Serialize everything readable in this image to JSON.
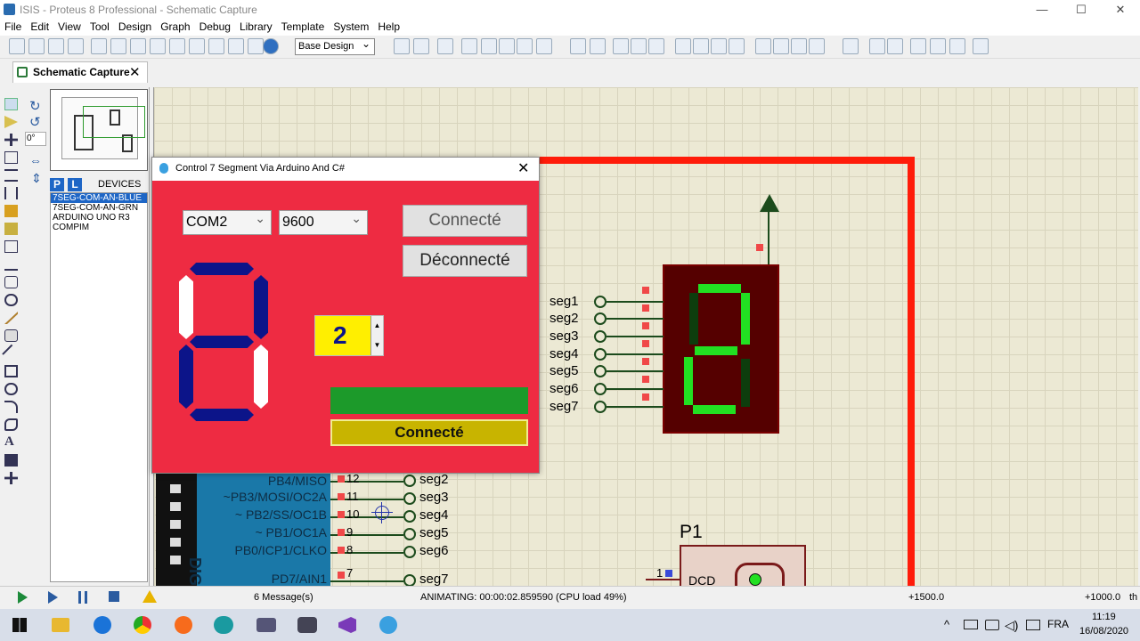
{
  "window": {
    "title": "ISIS - Proteus 8 Professional - Schematic Capture",
    "min": "—",
    "max": "☐",
    "close": "✕"
  },
  "menu": [
    "File",
    "Edit",
    "View",
    "Tool",
    "Design",
    "Graph",
    "Debug",
    "Library",
    "Template",
    "System",
    "Help"
  ],
  "toolbar": {
    "design_combo": "Base Design"
  },
  "tab": {
    "label": "Schematic Capture",
    "close": "✕"
  },
  "left": {
    "rotation": "0°"
  },
  "devices": {
    "p": "P",
    "l": "L",
    "header": "DEVICES",
    "items": [
      "7SEG-COM-AN-BLUE",
      "7SEG-COM-AN-GRN",
      "ARDUINO UNO R3",
      "COMPIM"
    ]
  },
  "schematic": {
    "seg_labels": [
      "seg1",
      "seg2",
      "seg3",
      "seg4",
      "seg5",
      "seg6",
      "seg7"
    ],
    "arduino_pins": [
      {
        "name": "PB4/MISO",
        "num": "12",
        "net": "seg2"
      },
      {
        "name": "~PB3/MOSI/OC2A",
        "num": "11",
        "net": "seg3"
      },
      {
        "name": "~ PB2/SS/OC1B",
        "num": "10",
        "net": "seg4"
      },
      {
        "name": "~ PB1/OC1A",
        "num": "9",
        "net": "seg5"
      },
      {
        "name": "PB0/ICP1/CLKO",
        "num": "8",
        "net": "seg6"
      },
      {
        "name": "PD7/AIN1",
        "num": "7",
        "net": "seg7"
      }
    ],
    "dig_label": "DIG",
    "p1_label": "P1",
    "p1_pin": "1",
    "p1_pin_name": "DCD"
  },
  "dialog": {
    "title": "Control 7 Segment Via Arduino And C#",
    "close": "✕",
    "port": "COM2",
    "baud": "9600",
    "connect_btn": "Connecté",
    "disconnect_btn": "Déconnecté",
    "digit_value": "2",
    "status_label": "Connecté",
    "colors": {
      "background": "#ee2b42",
      "segment_on": "#0c1489",
      "progress": "#1c9a2a",
      "status": "#c8b400",
      "digit_box": "#ffef00"
    }
  },
  "status": {
    "messages": "6 Message(s)",
    "animating": "ANIMATING: 00:00:02.859590 (CPU load 49%)",
    "coord1": "+1500.0",
    "coord2": "+1000.0",
    "th": "th"
  },
  "taskbar": {
    "lang": "FRA",
    "time": "11:19",
    "date": "16/08/2020"
  }
}
